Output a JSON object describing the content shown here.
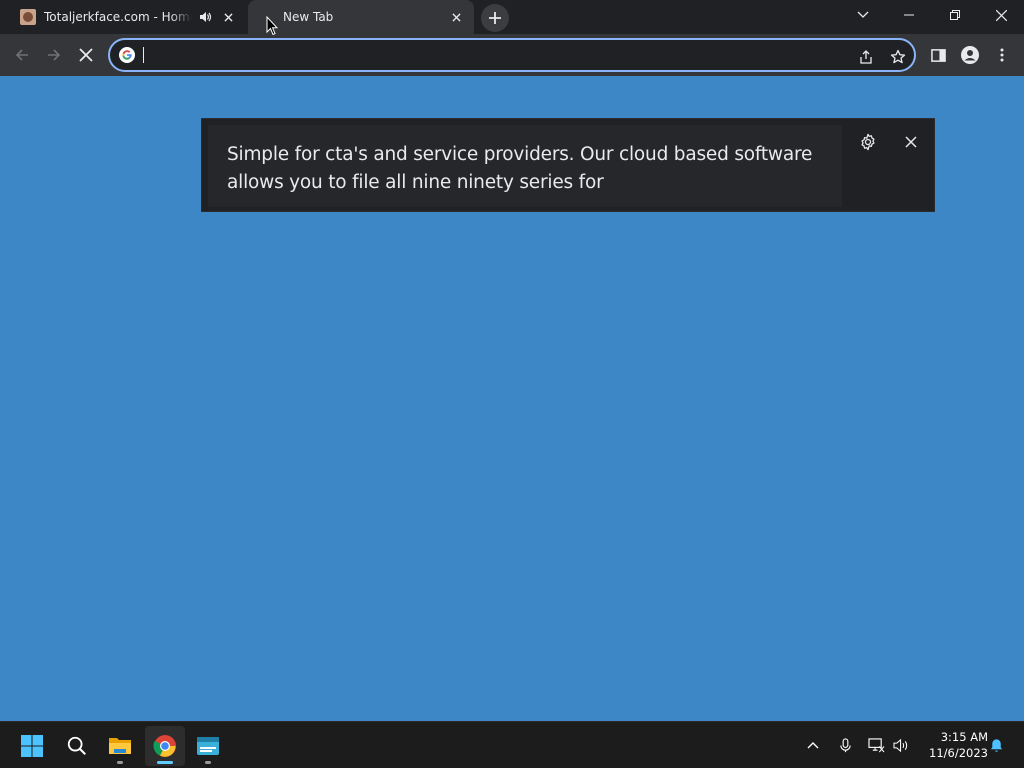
{
  "browser": {
    "tabs": [
      {
        "title": "Totaljerkface.com - Home O",
        "active": false,
        "audio": true
      },
      {
        "title": "New Tab",
        "active": true,
        "audio": false
      }
    ],
    "omnibox": {
      "value": "",
      "placeholder": ""
    }
  },
  "live_caption": {
    "text_line1": "Simple for cta's and service providers. Our cloud based software",
    "text_line2": "allows you to file all nine ninety series for"
  },
  "taskbar": {
    "time": "3:15 AM",
    "date": "11/6/2023"
  },
  "colors": {
    "page_background": "#3d87c7",
    "accent": "#8ab4f8",
    "caption_background": "#202124"
  }
}
